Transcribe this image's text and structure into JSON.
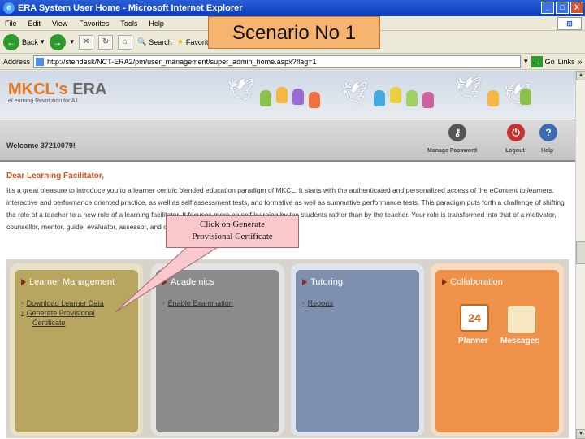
{
  "window": {
    "title": "ERA System User Home - Microsoft Internet Explorer",
    "controls": [
      "_",
      "□",
      "X"
    ]
  },
  "menu": [
    "File",
    "Edit",
    "View",
    "Favorites",
    "Tools",
    "Help"
  ],
  "toolbar": {
    "back": "Back",
    "search": "Search",
    "favorites": "Favorites"
  },
  "address": {
    "label": "Address",
    "url": "http://stendesk/NCT-ERA2/pm/user_management/super_admin_home.aspx?flag=1",
    "go": "Go",
    "links": "Links"
  },
  "overlay": {
    "scenario": "Scenario No 1",
    "callout_line1": "Click on Generate",
    "callout_line2": "Provisional Certificate"
  },
  "site": {
    "logo_main": "MKCL's",
    "logo_era": "ERA",
    "logo_sub": "eLearning Revolution for All",
    "welcome": "Welcome 37210079!",
    "manage_password": "Manage Password",
    "logout": "Logout",
    "help": "Help",
    "greeting": "Dear Learning Facilitator,",
    "intro": "It's a great pleasure to introduce you to a learner centric blended education paradigm of MKCL. It starts with the authenticated and personalized access of the eContent to learners, interactive and performance oriented practice, as well as self assessment tests, and formative as well as summative performance tests. This paradigm puts forth a challenge of shifting the role of a teacher to a new role of a learning facilitator. It focuses more on self learning by the students rather than by the teacher. Your role is transformed into that of a motivator, counsellor, mentor, guide, evaluator, assessor, and collaborator..."
  },
  "panels": {
    "learner": {
      "title": "Learner Management",
      "link1": "Download Learner Data",
      "link2": "Generate Provisional",
      "link2b": "Certificate"
    },
    "academics": {
      "title": "Academics",
      "link1": "Enable Examination"
    },
    "tutoring": {
      "title": "Tutoring",
      "link1": "Reports"
    },
    "collaboration": {
      "title": "Collaboration",
      "planner": "Planner",
      "messages": "Messages",
      "calendar_day": "24"
    }
  },
  "colors": {
    "learner": "#b8a660",
    "academics": "#8c8c8c",
    "tutoring": "#7e90ad",
    "collaboration": "#f0924a",
    "accent": "#d4531a"
  }
}
